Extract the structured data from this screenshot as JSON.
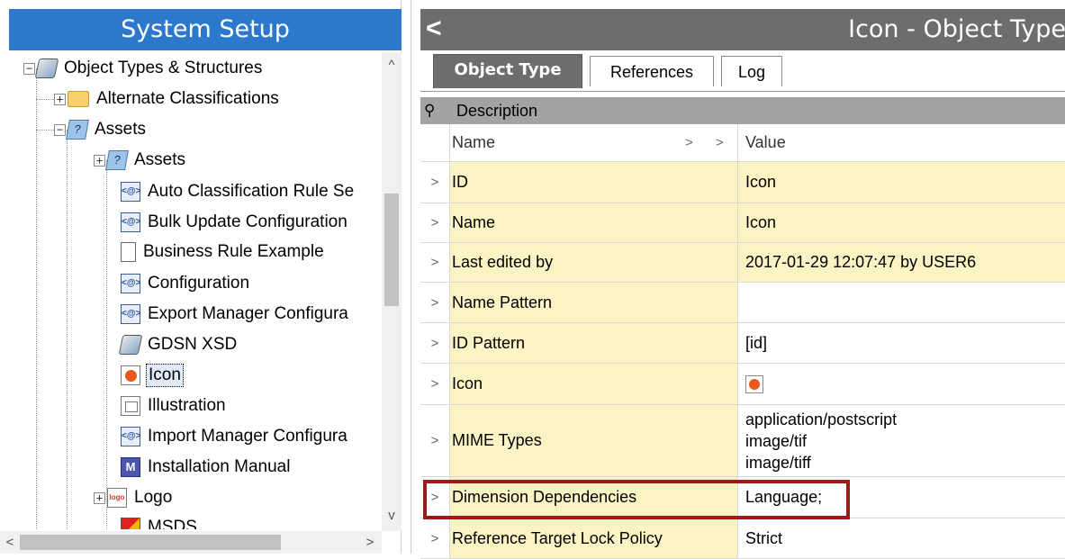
{
  "left": {
    "title": "System Setup",
    "tree": [
      {
        "label": "Object Types & Structures",
        "icon": "setup-gear-icon"
      },
      {
        "label": "Alternate Classifications",
        "icon": "folder-icon"
      },
      {
        "label": "Assets",
        "icon": "question-object-icon"
      },
      {
        "label": "Assets",
        "icon": "question-object-icon"
      },
      {
        "label": "Auto Classification Rule Se",
        "icon": "setup-object-icon"
      },
      {
        "label": "Bulk Update Configuration",
        "icon": "setup-object-icon"
      },
      {
        "label": "Business Rule Example",
        "icon": "document-icon"
      },
      {
        "label": "Configuration",
        "icon": "setup-object-icon"
      },
      {
        "label": "Export Manager Configura",
        "icon": "setup-object-icon"
      },
      {
        "label": "GDSN XSD",
        "icon": "setup-gear-icon"
      },
      {
        "label": "Icon",
        "icon": "red-dot-icon"
      },
      {
        "label": "Illustration",
        "icon": "illustration-icon"
      },
      {
        "label": "Import Manager Configura",
        "icon": "setup-object-icon"
      },
      {
        "label": "Installation Manual",
        "icon": "manual-icon"
      },
      {
        "label": "Logo",
        "icon": "logo-icon"
      },
      {
        "label": "MSDS",
        "icon": "hazard-icon"
      }
    ],
    "selected_item": "Icon"
  },
  "right": {
    "title": "Icon - Object Type",
    "tabs": [
      {
        "label": "Object Type",
        "active": true
      },
      {
        "label": "References",
        "active": false
      },
      {
        "label": "Log",
        "active": false
      }
    ],
    "group_label": "Description",
    "columns": {
      "name": "Name",
      "value": "Value"
    },
    "rows": [
      {
        "name": "ID",
        "value": "Icon"
      },
      {
        "name": "Name",
        "value": "Icon"
      },
      {
        "name": "Last edited by",
        "value": "2017-01-29 12:07:47 by USER6"
      },
      {
        "name": "Name Pattern",
        "value": ""
      },
      {
        "name": "ID Pattern",
        "value": "[id]"
      },
      {
        "name": "Icon",
        "value": ""
      },
      {
        "name": "MIME Types",
        "values": [
          "application/postscript",
          "image/tif",
          "image/tiff"
        ]
      },
      {
        "name": "Dimension Dependencies",
        "value": "Language;"
      },
      {
        "name": "Reference Target Lock Policy",
        "value": "Strict"
      }
    ]
  },
  "colors": {
    "left_header": "#2b78cc",
    "right_header": "#6d6d6d",
    "row_highlight": "#fcf3c4",
    "annotation_box": "#9b1b1b"
  }
}
